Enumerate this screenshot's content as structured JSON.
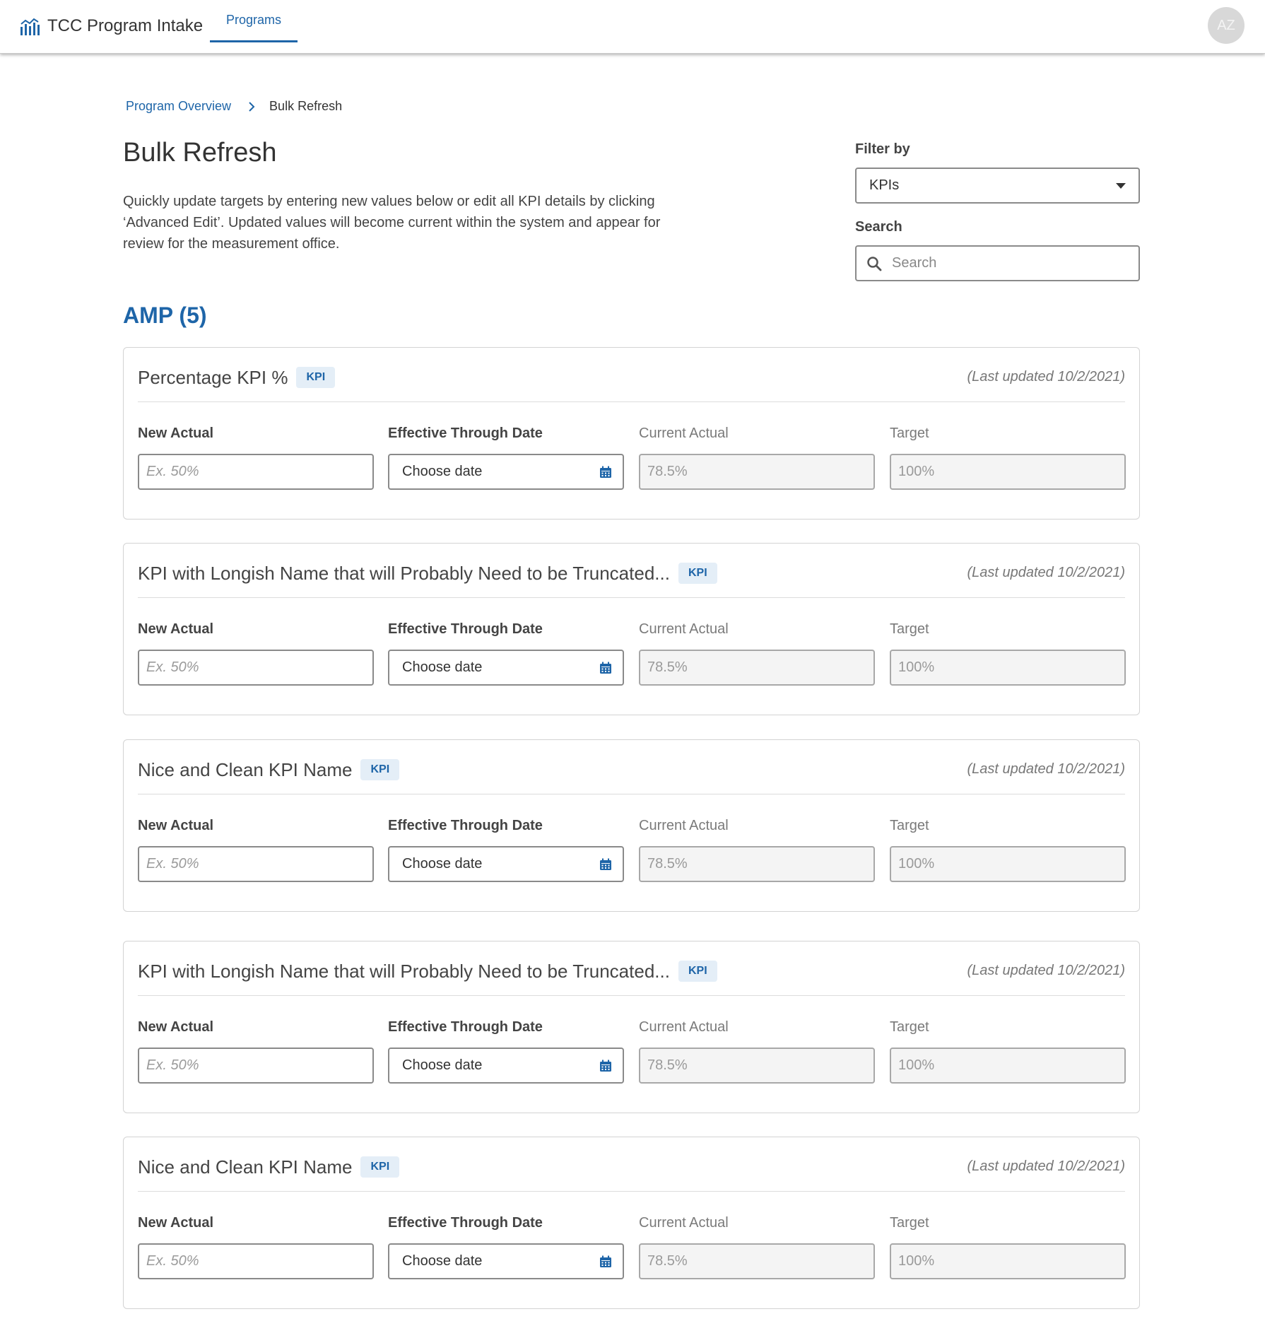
{
  "app": {
    "title": "TCC Program Intake",
    "nav_tab": "Programs",
    "avatar_initials": "AZ",
    "accent_color": "#1e65a8"
  },
  "breadcrumb": {
    "parent": "Program Overview",
    "current": "Bulk Refresh"
  },
  "page": {
    "title": "Bulk Refresh",
    "description": "Quickly update targets by entering new values below or edit all KPI details by clicking ‘Advanced Edit’.  Updated values will become current within the system and appear for review for the measurement office."
  },
  "filter": {
    "label": "Filter by",
    "selected": "KPIs"
  },
  "search": {
    "label": "Search",
    "placeholder": "Search"
  },
  "section": {
    "title": "AMP (5)"
  },
  "field_labels": {
    "new_actual": "New Actual",
    "effective_date": "Effective Through Date",
    "current_actual": "Current Actual",
    "target": "Target"
  },
  "kpis": [
    {
      "name": "Percentage KPI %",
      "badge": "KPI",
      "last_updated": "(Last updated 10/2/2021)",
      "new_actual_placeholder": "Ex. 50%",
      "date_placeholder": "Choose date",
      "current_actual": "78.5%",
      "target": "100%"
    },
    {
      "name": "KPI with Longish Name that will Probably Need to be Truncated...",
      "badge": "KPI",
      "last_updated": "(Last updated 10/2/2021)",
      "new_actual_placeholder": "Ex. 50%",
      "date_placeholder": "Choose date",
      "current_actual": "78.5%",
      "target": "100%"
    },
    {
      "name": "Nice and Clean KPI Name",
      "badge": "KPI",
      "last_updated": "(Last updated 10/2/2021)",
      "new_actual_placeholder": "Ex. 50%",
      "date_placeholder": "Choose date",
      "current_actual": "78.5%",
      "target": "100%"
    },
    {
      "name": "KPI with Longish Name that will Probably Need to be Truncated...",
      "badge": "KPI",
      "last_updated": "(Last updated 10/2/2021)",
      "new_actual_placeholder": "Ex. 50%",
      "date_placeholder": "Choose date",
      "current_actual": "78.5%",
      "target": "100%"
    },
    {
      "name": "Nice and Clean KPI Name",
      "badge": "KPI",
      "last_updated": "(Last updated 10/2/2021)",
      "new_actual_placeholder": "Ex. 50%",
      "date_placeholder": "Choose date",
      "current_actual": "78.5%",
      "target": "100%"
    }
  ]
}
